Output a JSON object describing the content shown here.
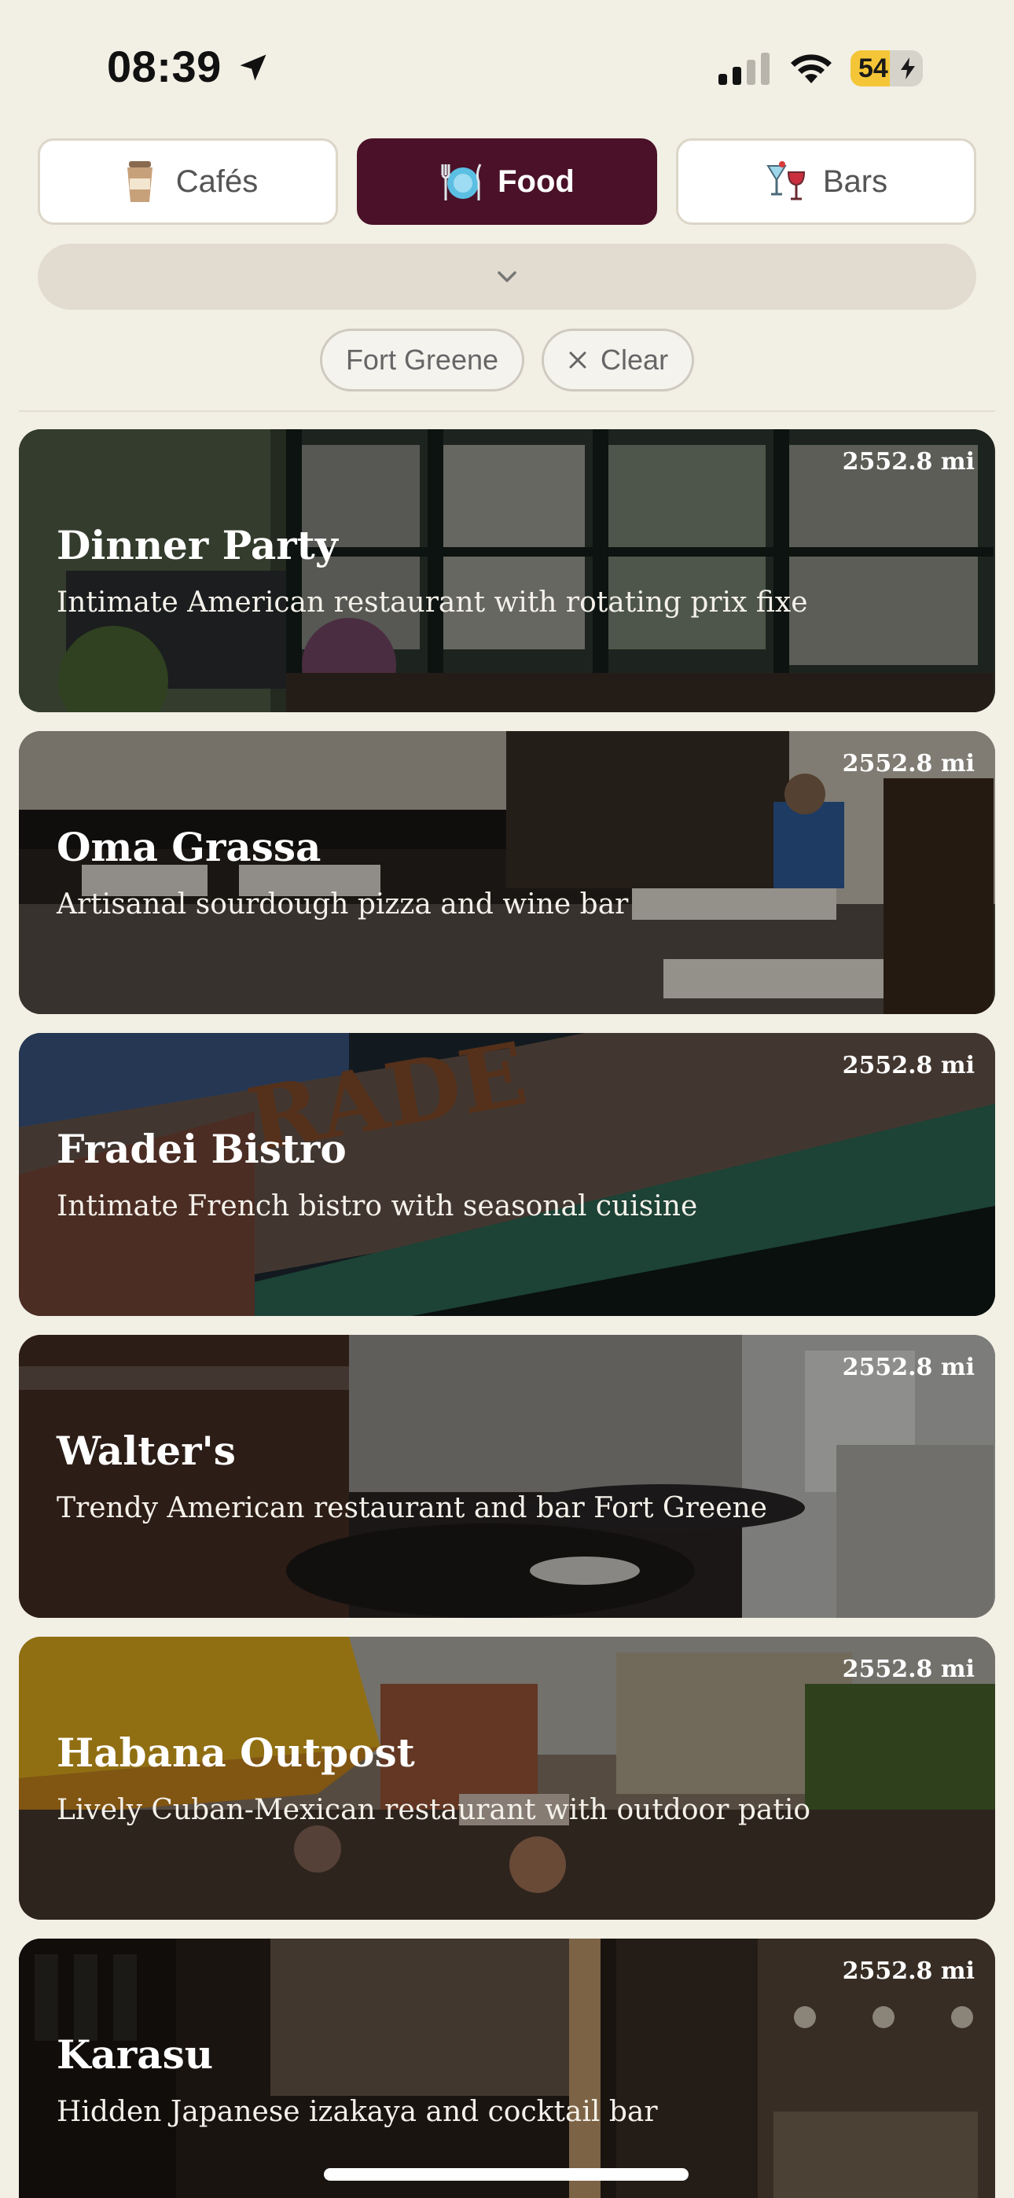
{
  "status": {
    "time": "08:39",
    "battery": "54",
    "battery_level": 0.54
  },
  "tabs": [
    {
      "label": "Cafés",
      "icon": "coffee-cup-icon",
      "active": false
    },
    {
      "label": "Food",
      "icon": "plate-cutlery-icon",
      "active": true
    },
    {
      "label": "Bars",
      "icon": "cocktail-glasses-icon",
      "active": false
    }
  ],
  "filters": {
    "neighborhood": "Fort Greene",
    "clear_label": "Clear"
  },
  "restaurants": [
    {
      "name": "Dinner Party",
      "description": "Intimate American restaurant with rotating prix fixe",
      "distance": "2552.8 mi"
    },
    {
      "name": "Oma Grassa",
      "description": "Artisanal sourdough pizza and wine bar",
      "distance": "2552.8 mi"
    },
    {
      "name": "Fradei Bistro",
      "description": "Intimate French bistro with seasonal cuisine",
      "distance": "2552.8 mi"
    },
    {
      "name": "Walter's",
      "description": "Trendy American restaurant and bar Fort Greene",
      "distance": "2552.8 mi"
    },
    {
      "name": "Habana Outpost",
      "description": "Lively Cuban-Mexican restaurant with outdoor patio",
      "distance": "2552.8 mi"
    },
    {
      "name": "Karasu",
      "description": "Hidden Japanese izakaya and cocktail bar",
      "distance": "2552.8 mi"
    }
  ],
  "colors": {
    "background": "#f2efe5",
    "accent": "#4a1128",
    "chip_bg": "#f5f3ee",
    "dropdown_bg": "#e2dbcf",
    "battery": "#f4c637"
  }
}
